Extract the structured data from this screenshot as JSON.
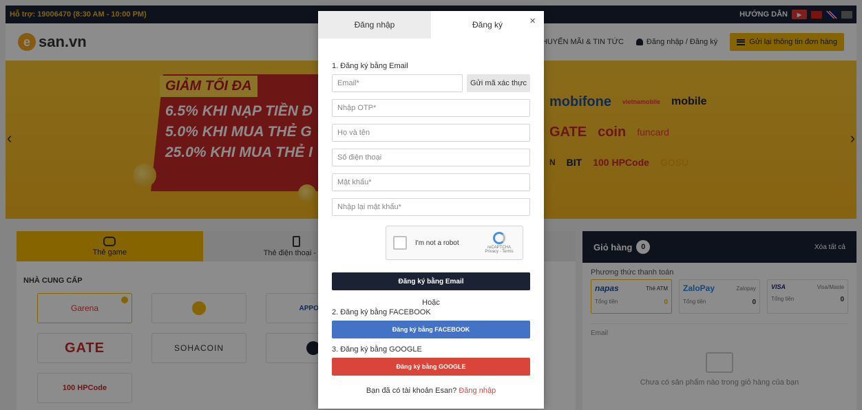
{
  "topbar": {
    "support": "Hỗ trợ: 19006470 (8:30 AM - 10:00 PM)",
    "guide": "HƯỚNG DẪN",
    "play_icon": "▶"
  },
  "header": {
    "logo_text": "san.vn",
    "logo_mark": "e",
    "news": "KHUYẾN MÃI & TIN TỨC",
    "login": "Đăng nhập / Đăng ký",
    "order_lookup": "Gửi lại thông tin đơn hàng"
  },
  "banner": {
    "tag": "GIẢM TỐI ĐA",
    "promos": [
      "6.5% KHI NẠP TIỀN Đ",
      "5.0% KHI MUA THẺ G",
      "25.0% KHI MUA THẺ I"
    ],
    "arrow_left": "‹",
    "arrow_right": "›",
    "partners_row1": [
      "mobifone",
      "vietnamobile",
      "mobile"
    ],
    "partners_row2": [
      "GATE",
      "coin",
      "funcard"
    ],
    "partners_row3": [
      "N",
      "BIT",
      "100 HPCode",
      "GOSU"
    ]
  },
  "main": {
    "tabs": [
      {
        "label": "Thẻ game"
      },
      {
        "label": "Thẻ điện thoại - dat"
      }
    ],
    "section_title": "NHÀ CUNG CẤP",
    "providers": [
      "Garena",
      "",
      "APPOTA",
      "GATE",
      "SOHACOIN",
      "",
      "100 HPCode"
    ]
  },
  "cart": {
    "title": "Giỏ hàng",
    "count": "0",
    "clear_all": "Xóa tất cả",
    "payment_title": "Phương thức thanh toán",
    "methods": [
      {
        "brand": "napas",
        "name": "Thẻ ATM",
        "total_label": "Tổng tiền",
        "total": "0"
      },
      {
        "brand": "ZaloPay",
        "name": "Zalopay",
        "total_label": "Tổng tiền",
        "total": "0"
      },
      {
        "brand": "VISA",
        "name": "Visa/Maste",
        "total_label": "Tổng tiền",
        "total": "0"
      }
    ],
    "email_label": "Email",
    "empty_text": "Chưa có sản phẩm nào trong giỏ hàng của bạn"
  },
  "modal": {
    "tab_login": "Đăng nhập",
    "tab_register": "Đăng ký",
    "close": "×",
    "step1": "1. Đăng ký bằng Email",
    "email_placeholder": "Email*",
    "send_otp": "Gửi mã xác thực",
    "otp_placeholder": "Nhập OTP*",
    "name_placeholder": "Họ và tên",
    "phone_placeholder": "Số điện thoại",
    "password_placeholder": "Mật khẩu*",
    "confirm_placeholder": "Nhập lại mật khẩu*",
    "captcha_label": "I'm not a robot",
    "captcha_brand": "reCAPTCHA",
    "captcha_terms": "Privacy - Terms",
    "register_email_btn": "Đăng ký bằng Email",
    "or": "Hoặc",
    "step2": "2. Đăng ký bằng FACEBOOK",
    "facebook_btn": "Đăng ký bằng FACEBOOK",
    "step3": "3. Đăng ký bằng GOOGLE",
    "google_btn": "Đăng ký bằng GOOGLE",
    "footer_question": "Bạn đã có tài khoản Esan?",
    "footer_link": "Đăng nhập"
  },
  "colors": {
    "accent": "#f5b800",
    "navy": "#1b2234",
    "facebook": "#4472c4",
    "google": "#d9453a"
  }
}
